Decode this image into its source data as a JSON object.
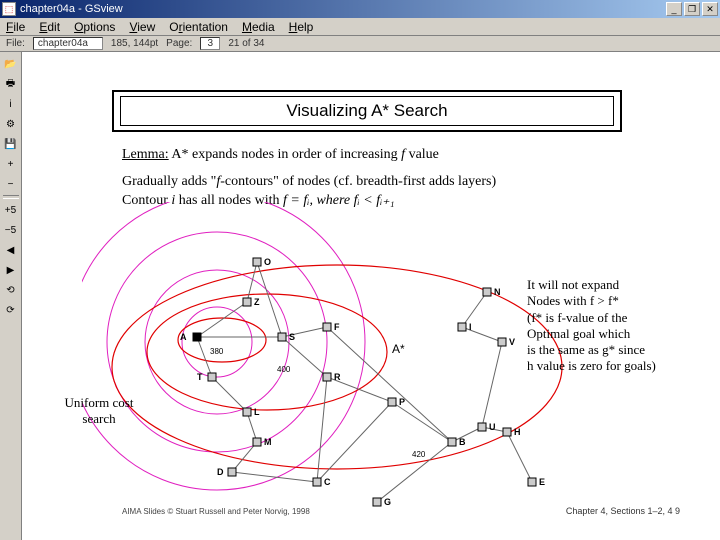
{
  "window": {
    "title": "chapter04a - GSview",
    "min": "_",
    "restore": "❐",
    "close": "✕"
  },
  "menubar": {
    "file": "File",
    "edit": "Edit",
    "options": "Options",
    "view": "View",
    "orientation": "Orientation",
    "media": "Media",
    "help": "Help"
  },
  "status": {
    "file": "chapter04a",
    "dims": "185, 144pt",
    "page_label": "Page:",
    "page_current": "3",
    "page_total": "21 of 34"
  },
  "toolbar": {
    "open": "📂",
    "print": "🖶",
    "info": "i",
    "settings": "⚙",
    "save": "💾",
    "plus": "+",
    "minus": "−",
    "zoomin": "+5",
    "zoomout": "−5",
    "prev": "◀",
    "next": "▶",
    "rev": "⟲",
    "fwd": "⟳"
  },
  "slide": {
    "title": "Visualizing A* Search",
    "lemma_label": "Lemma:",
    "lemma_text": "A* expands nodes in order of increasing f value",
    "body1a": "Gradually adds \"",
    "body1b": "f",
    "body1c": "-contours\" of nodes (cf. breadth-first adds layers)",
    "body2a": "Contour ",
    "body2b": "i",
    "body2c": " has all nodes with ",
    "body2d": "f = fᵢ, where fᵢ < fᵢ₊₁"
  },
  "annotations": {
    "ucs": "Uniform cost search",
    "astar": "A*",
    "right": "It will not expand\nNodes with f > f*\n(f* is f-value of the\nOptimal goal which\nis the same as g* since\nh value is zero for goals)"
  },
  "graph": {
    "nodes": {
      "O": "O",
      "Z": "Z",
      "A": "A",
      "S": "S",
      "T": "T",
      "L": "L",
      "M": "M",
      "D": "D",
      "R": "R",
      "F": "F",
      "C": "C",
      "P": "P",
      "G": "G",
      "B": "B",
      "N": "N",
      "I": "I",
      "V": "V",
      "U": "U",
      "H": "H",
      "E": "E"
    },
    "edge_labels": {
      "e380": "380",
      "e400": "400",
      "e420": "420"
    }
  },
  "footer": {
    "cite": "AIMA Slides © Stuart Russell and Peter Norvig, 1998",
    "chap": "Chapter 4, Sections 1–2, 4    9"
  }
}
